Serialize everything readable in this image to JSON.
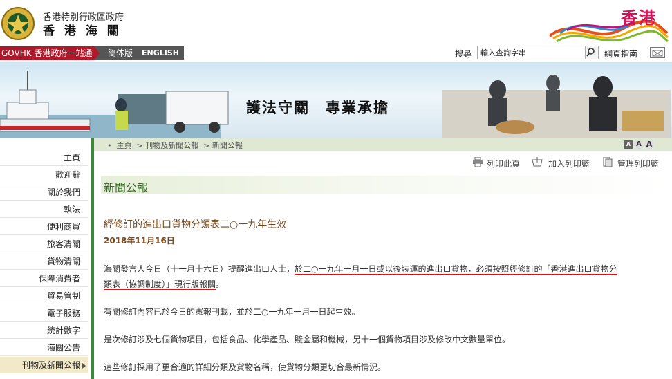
{
  "header": {
    "dept_line1": "香港特別行政區政府",
    "dept_name": "香 港 海 關",
    "brand": "香港"
  },
  "nav": {
    "gov_link": "GOVHK 香港政府一站通",
    "lang_simplified": "简体版",
    "lang_english": "ENGLISH",
    "search_label": "搜尋",
    "search_placeholder": "輸入查詢字串",
    "sitemap": "網頁指南"
  },
  "banner": {
    "slogan": "護法守關　專業承擔"
  },
  "breadcrumb": [
    "主頁",
    "刊物及新聞公報",
    "新聞公報"
  ],
  "font_sizes": [
    "A",
    "A",
    "A"
  ],
  "tools": {
    "print": "列印此頁",
    "add_print": "加入列印籃",
    "manage_print": "管理列印籃"
  },
  "sidebar": {
    "items": [
      {
        "label": "主頁"
      },
      {
        "label": "歡迎辭"
      },
      {
        "label": "關於我們"
      },
      {
        "label": "執法"
      },
      {
        "label": "便利商貿"
      },
      {
        "label": "旅客清關"
      },
      {
        "label": "貨物清關"
      },
      {
        "label": "保障消費者"
      },
      {
        "label": "貿易管制"
      },
      {
        "label": "電子服務"
      },
      {
        "label": "統計數字"
      },
      {
        "label": "海關公告"
      },
      {
        "label": "刊物及新聞公報"
      }
    ],
    "active_index": 12
  },
  "content": {
    "section_title": "新聞公報",
    "article_title": "經修訂的進出口貨物分類表二○一九年生效",
    "date": "2018年11月16日",
    "p1_part1": "海關發言人今日（十一月十六日）提醒進出口人士，",
    "p1_underlined_a": "於二○一九年一月一日或以後裝運的進出口貨物，必須按照經修訂的「香港進出口貨物分",
    "p1_underlined_b": "類表（協調制度）」現行版報關",
    "p1_end": "。",
    "p2": "有關修訂內容已於今日的憲報刊載，並於二○一九年一月一日起生效。",
    "p3": "是次修訂涉及七個貨物項目，包括食品、化學產品、賤金屬和機械，另十一個貨物項目涉及修改中文數量單位。",
    "p4": "這些修訂採用了更合適的詳細分類及貨物名稱，使貨物分類更切合最新情況。"
  },
  "colors": {
    "gov_red": "#b0182a",
    "sidebar_green": "#3a8a3a",
    "title_green": "#3d6b2c",
    "article_brown": "#7a4a1e",
    "underline_red": "#d01818",
    "brand_pink": "#d4145a"
  }
}
